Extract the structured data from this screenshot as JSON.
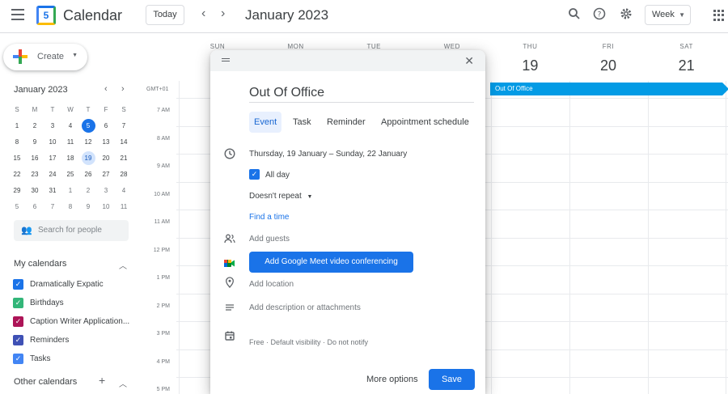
{
  "header": {
    "app_title": "Calendar",
    "logo_day": "5",
    "today_label": "Today",
    "month_title": "January 2023",
    "view_label": "Week"
  },
  "sidebar": {
    "create_label": "Create",
    "mini_calendar": {
      "title": "January 2023",
      "weekday_headers": [
        "S",
        "M",
        "T",
        "W",
        "T",
        "F",
        "S"
      ],
      "weeks": [
        [
          "1",
          "2",
          "3",
          "4",
          "5",
          "6",
          "7"
        ],
        [
          "8",
          "9",
          "10",
          "11",
          "12",
          "13",
          "14"
        ],
        [
          "15",
          "16",
          "17",
          "18",
          "19",
          "20",
          "21"
        ],
        [
          "22",
          "23",
          "24",
          "25",
          "26",
          "27",
          "28"
        ],
        [
          "29",
          "30",
          "31",
          "1",
          "2",
          "3",
          "4"
        ],
        [
          "5",
          "6",
          "7",
          "8",
          "9",
          "10",
          "11"
        ]
      ],
      "today": "5",
      "selected": "19"
    },
    "search_placeholder": "Search for people",
    "my_calendars_title": "My calendars",
    "my_calendars": [
      {
        "label": "Dramatically Expatic",
        "color": "#1a73e8"
      },
      {
        "label": "Birthdays",
        "color": "#33b679"
      },
      {
        "label": "Caption Writer Application...",
        "color": "#ad1457"
      },
      {
        "label": "Reminders",
        "color": "#3f51b5"
      },
      {
        "label": "Tasks",
        "color": "#4285f4"
      }
    ],
    "other_calendars_title": "Other calendars"
  },
  "week": {
    "days": [
      {
        "name": "SUN",
        "num": ""
      },
      {
        "name": "MON",
        "num": ""
      },
      {
        "name": "TUE",
        "num": ""
      },
      {
        "name": "WED",
        "num": ""
      },
      {
        "name": "THU",
        "num": "19"
      },
      {
        "name": "FRI",
        "num": "20"
      },
      {
        "name": "SAT",
        "num": "21"
      }
    ],
    "timezone": "GMT+01",
    "time_labels": [
      "7 AM",
      "8 AM",
      "9 AM",
      "10 AM",
      "11 AM",
      "12 PM",
      "1 PM",
      "2 PM",
      "3 PM",
      "4 PM",
      "5 PM"
    ],
    "allday_event": "Out Of Office"
  },
  "dialog": {
    "title_value": "Out Of Office",
    "tabs": [
      "Event",
      "Task",
      "Reminder",
      "Appointment schedule"
    ],
    "active_tab": "Event",
    "date_range": "Thursday, 19 January  –  Sunday, 22 January",
    "all_day_label": "All day",
    "repeat_label": "Doesn't repeat",
    "find_time_label": "Find a time",
    "guests_placeholder": "Add guests",
    "meet_button": "Add Google Meet video conferencing",
    "location_placeholder": "Add location",
    "description_placeholder": "Add description or attachments",
    "calendar_info": "Free · Default visibility · Do not notify",
    "more_options_label": "More options",
    "save_label": "Save"
  },
  "colors": {
    "accent": "#1a73e8",
    "event": "#039be5"
  }
}
